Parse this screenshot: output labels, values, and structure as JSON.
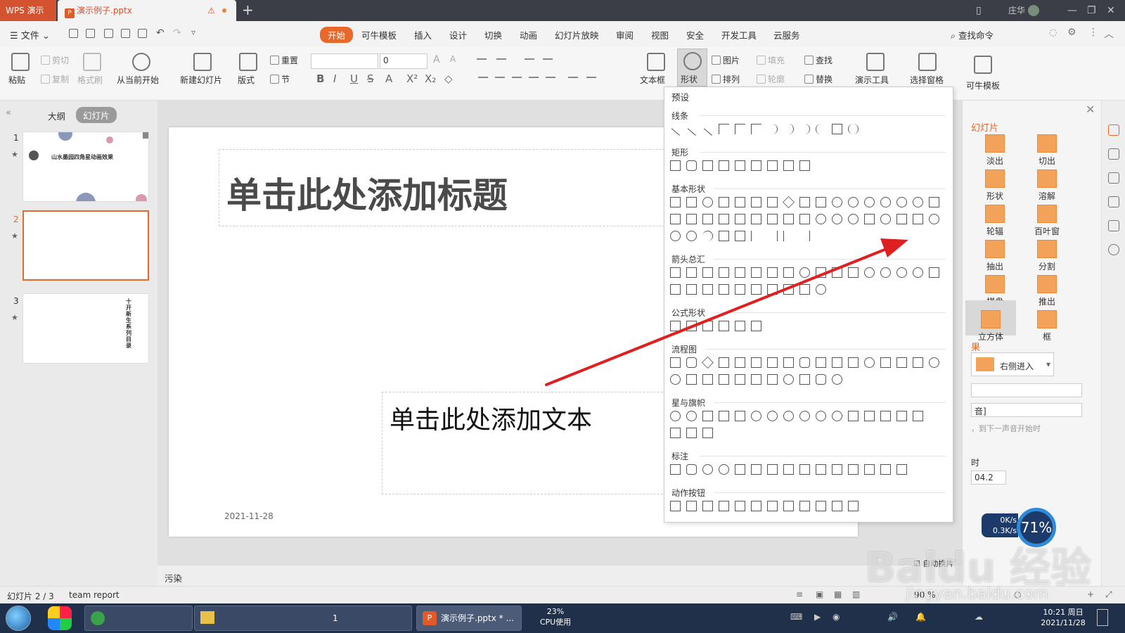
{
  "titlebar": {
    "app_tab": "WPS 演示",
    "doc_tab": "演示例子.pptx",
    "user": "庄华"
  },
  "menu": {
    "file": "文件",
    "tabs": [
      "开始",
      "可牛模板",
      "插入",
      "设计",
      "切换",
      "动画",
      "幻灯片放映",
      "审阅",
      "视图",
      "安全",
      "开发工具",
      "云服务"
    ],
    "search": "查找命令"
  },
  "ribbon": {
    "paste": "粘贴",
    "cut": "剪切",
    "copy": "复制",
    "format_painter": "格式刷",
    "from_current": "从当前开始",
    "new_slide": "新建幻灯片",
    "layout": "版式",
    "reset": "重置",
    "section": "节",
    "font_size": "0",
    "textbox": "文本框",
    "shape": "形状",
    "picture": "图片",
    "arrange": "排列",
    "fill": "填充",
    "outline": "轮廓",
    "find": "查找",
    "replace": "替换",
    "present_tools": "演示工具",
    "selection_pane": "选择窗格",
    "kn_template": "可牛模板"
  },
  "left_panel": {
    "outline_tab": "大纲",
    "slides_tab": "幻灯片",
    "thumb1_title": "山水墨园四角星动画效果",
    "thumb3_text": "十开新生系列目录"
  },
  "slide": {
    "title_placeholder": "单击此处添加标题",
    "body_placeholder": "单击此处添加文本",
    "date": "2021-11-28"
  },
  "notes": "污染",
  "shape_dropdown": {
    "header": "预设",
    "sections": [
      "线条",
      "矩形",
      "基本形状",
      "箭头总汇",
      "公式形状",
      "流程图",
      "星与旗帜",
      "标注",
      "动作按钮"
    ]
  },
  "right_pane": {
    "title": "幻灯片",
    "transitions": [
      "淡出",
      "切出",
      "形状",
      "溶解",
      "轮辐",
      "百叶窗",
      "抽出",
      "分割",
      "棋盘",
      "推出",
      "立方体",
      "框"
    ],
    "effect_title": "果",
    "effect_value": "右侧进入",
    "sound_value": "音]",
    "sound_note": "，到下一声音开始时",
    "time_label": "时",
    "time_value": "04.2",
    "auto_label": "自动换片"
  },
  "statusbar": {
    "slide_info": "幻灯片 2 / 3",
    "theme": "team report",
    "zoom": "90 %"
  },
  "taskbar": {
    "task_ppt": "演示例子.pptx * ...",
    "task_folder_count": "1",
    "cpu_percent": "23%",
    "cpu_label": "CPU使用",
    "clock_time": "10:21 周日",
    "clock_date": "2021/11/28"
  },
  "net_widget": {
    "up": "0K/s",
    "down": "0.3K/s",
    "percent": "71%"
  },
  "watermark": {
    "main": "Baidu 经验",
    "sub": "jingyan.baidu.com"
  },
  "colors": {
    "accent": "#e8672a",
    "arrow": "#e02020",
    "titlebar": "#3b3e46",
    "taskbar": "#20304a"
  }
}
